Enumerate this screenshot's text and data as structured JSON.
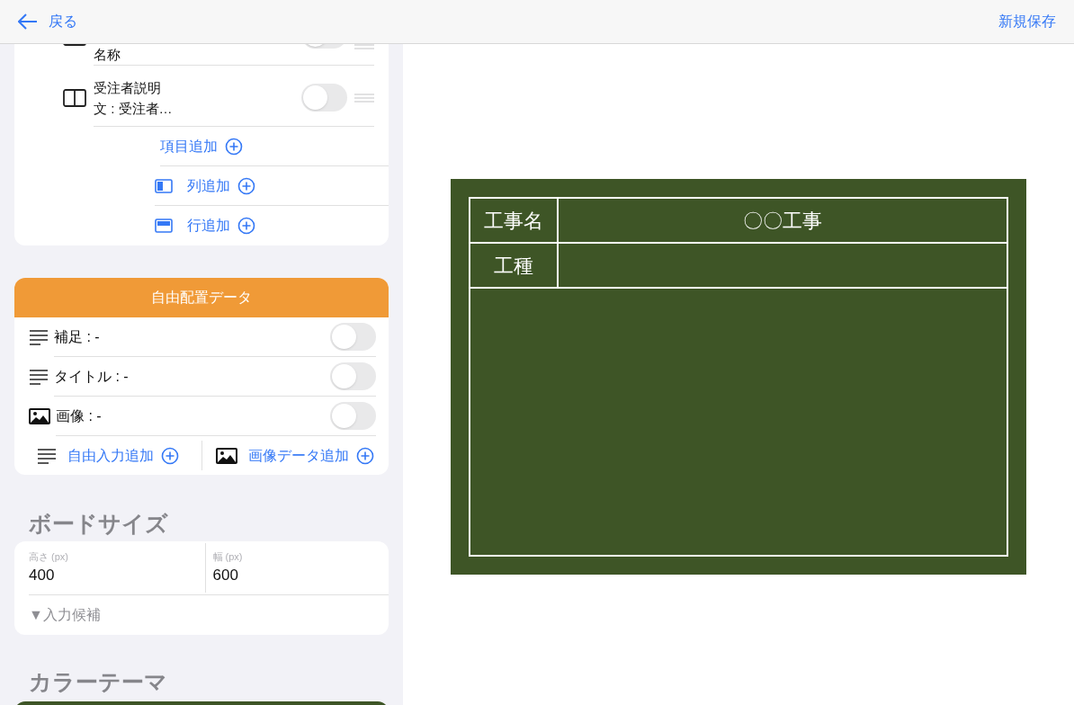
{
  "nav": {
    "back_label": "戻る",
    "save_label": "新規保存"
  },
  "layout_card": {
    "items": [
      {
        "label": "名称",
        "on": false
      },
      {
        "label": "受注者説明文 : 受注者…",
        "on": false
      }
    ],
    "actions": [
      {
        "kind": "item",
        "label": "項目追加"
      },
      {
        "kind": "column",
        "label": "列追加"
      },
      {
        "kind": "row",
        "label": "行追加"
      }
    ]
  },
  "free_card": {
    "header": "自由配置データ",
    "items": [
      {
        "kind": "text",
        "label": "補足 : -",
        "on": false
      },
      {
        "kind": "text",
        "label": "タイトル : -",
        "on": false
      },
      {
        "kind": "image",
        "label": "画像 : -",
        "on": false
      }
    ],
    "actions": [
      {
        "kind": "text",
        "label": "自由入力追加"
      },
      {
        "kind": "image",
        "label": "画像データ追加"
      }
    ]
  },
  "board_size": {
    "title": "ボードサイズ",
    "fields": [
      {
        "label": "高さ (px)",
        "value": "400"
      },
      {
        "label": "幅 (px)",
        "value": "600"
      }
    ],
    "suggestions": "▼入力候補"
  },
  "color_theme": {
    "title": "カラーテーマ"
  },
  "board": {
    "rows": [
      {
        "header": "工事名",
        "value": "〇〇工事"
      },
      {
        "header": "工種",
        "value": ""
      }
    ]
  }
}
